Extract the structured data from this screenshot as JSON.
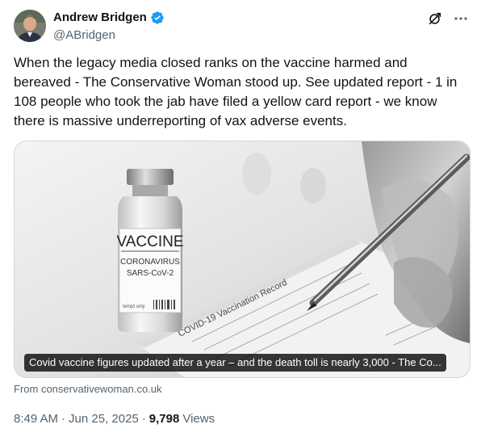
{
  "author": {
    "display_name": "Andrew Bridgen",
    "handle": "@ABridgen",
    "verified": true,
    "verified_color": "#1d9bf0"
  },
  "icons": {
    "verified": "verified-badge-icon",
    "grok": "grok-icon",
    "more": "more-icon"
  },
  "tweet": {
    "text": "When the legacy media closed ranks on the vaccine harmed and bereaved - The Conservative Woman stood up. See updated report - 1 in 108 people who took the jab have filed a yellow card report - we know there is massive underreporting of vax adverse events."
  },
  "card": {
    "image_text": {
      "vaccine": "VACCINE",
      "coronavirus": "CORONAVIRUS",
      "sars": "SARS-CoV-2",
      "use_only": "tempt only",
      "form_title": "COVID-19 Vaccination Record"
    },
    "title": "Covid vaccine figures updated after a year – and the death toll is nearly 3,000 - The Co...",
    "source": "From conservativewoman.co.uk"
  },
  "meta": {
    "time": "8:49 AM",
    "separator1": "·",
    "date": "Jun 25, 2025",
    "separator2": "·",
    "views_count": "9,798",
    "views_label": "Views"
  }
}
